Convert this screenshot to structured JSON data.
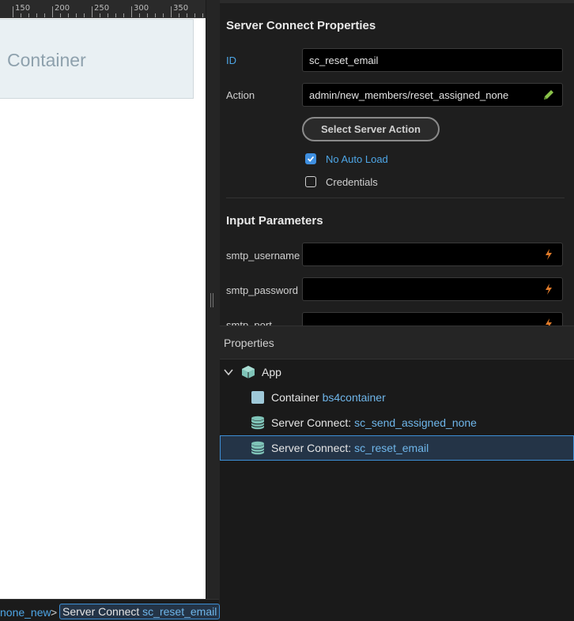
{
  "ruler": {
    "ticks": [
      "150",
      "200",
      "250",
      "300",
      "350"
    ]
  },
  "canvas": {
    "container_label": "Container"
  },
  "breadcrumb": {
    "parent": "none_new",
    "separator": ">",
    "current_type": "Server Connect",
    "current_id": "sc_reset_email"
  },
  "props": {
    "title": "Server Connect Properties",
    "id_label": "ID",
    "id_value": "sc_reset_email",
    "action_label": "Action",
    "action_value": "admin/new_members/reset_assigned_none",
    "select_action_button": "Select Server Action",
    "no_auto_load_label": "No Auto Load",
    "no_auto_load_checked": true,
    "credentials_label": "Credentials",
    "credentials_checked": false,
    "input_params_title": "Input Parameters",
    "params": [
      {
        "name": "smtp_username",
        "value": ""
      },
      {
        "name": "smtp_password",
        "value": ""
      },
      {
        "name": "smtp_port",
        "value": ""
      }
    ]
  },
  "tree": {
    "header": "Properties",
    "items": [
      {
        "type": "App",
        "id": "",
        "icon": "cube-icon",
        "expanded": true
      },
      {
        "type": "Container",
        "id": "bs4container",
        "icon": "container-icon"
      },
      {
        "type": "Server Connect:",
        "id": "sc_send_assigned_none",
        "icon": "database-icon"
      },
      {
        "type": "Server Connect:",
        "id": "sc_reset_email",
        "icon": "database-icon",
        "selected": true
      }
    ]
  },
  "colors": {
    "accent": "#3f8fe0",
    "link": "#4ea6e6",
    "dynamic_icon": "#e07b2a",
    "pencil_icon": "#8bc34a",
    "db_icon": "#7fc4b8"
  }
}
